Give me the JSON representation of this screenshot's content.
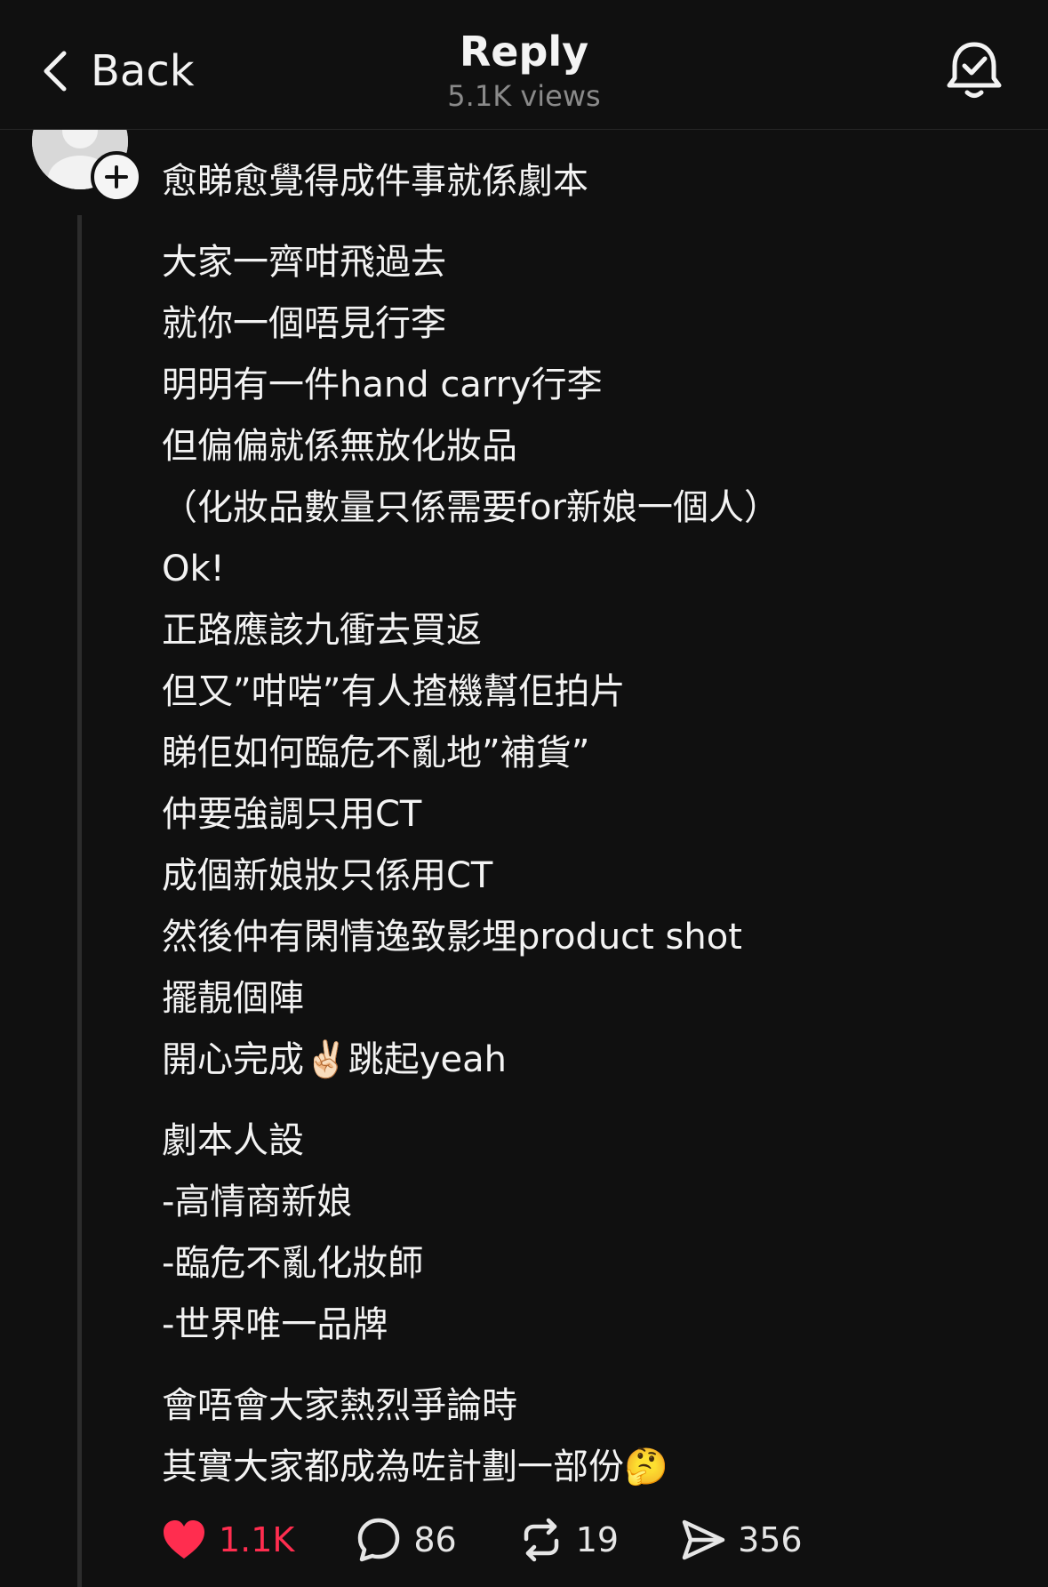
{
  "header": {
    "back_label": "Back",
    "title": "Reply",
    "views": "5.1K views",
    "bell_icon": "bell-check-icon"
  },
  "post": {
    "avatar_icon": "default-avatar-icon",
    "follow_icon": "plus-icon",
    "lines": [
      "愈睇愈覺得成件事就係劇本",
      "",
      "大家一齊咁飛過去",
      "就你一個唔見行李",
      "明明有一件hand carry行李",
      "但偏偏就係無放化妝品",
      "（化妝品數量只係需要for新娘一個人）",
      "Ok!",
      "正路應該九衝去買返",
      "但又”咁啱”有人揸機幫佢拍片",
      "睇佢如何臨危不亂地”補貨”",
      "仲要強調只用CT",
      "成個新娘妝只係用CT",
      "然後仲有閑情逸致影埋product shot",
      "擺靚個陣",
      "開心完成✌🏻跳起yeah",
      "",
      "劇本人設",
      "-高情商新娘",
      "-臨危不亂化妝師",
      "-世界唯一品牌",
      "",
      "會唔會大家熱烈爭論時",
      "其實大家都成為咗計劃一部份🤔"
    ]
  },
  "actions": {
    "likes": "1.1K",
    "comments": "86",
    "reposts": "19",
    "shares": "356",
    "like_color": "#ff2d4f"
  }
}
